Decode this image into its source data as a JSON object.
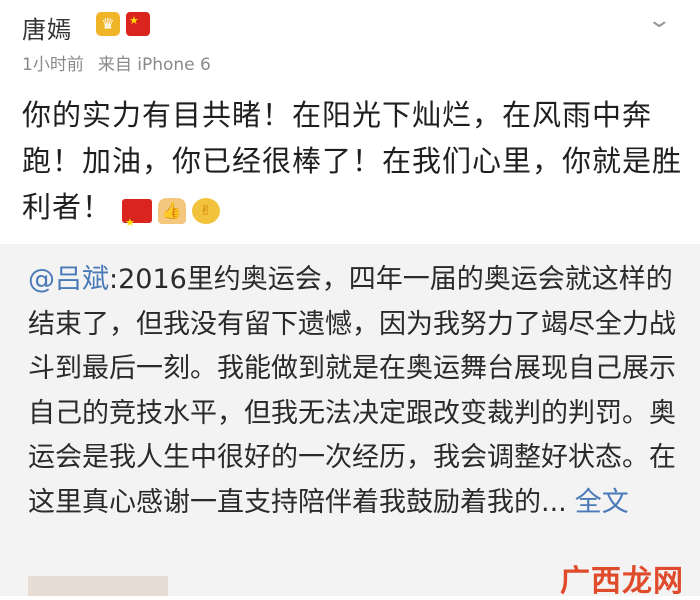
{
  "post": {
    "username": "唐嫣",
    "time": "1小时前",
    "source": "来自 iPhone 6",
    "text": "你的实力有目共睹！在阳光下灿烂，在风雨中奔跑！加油，你已经很棒了！在我们心里，你就是胜利者！",
    "badges": [
      "crown-badge-icon",
      "china-flag-badge-icon"
    ],
    "emojis": [
      "china-flag-emoji",
      "thumbs-up-emoji",
      "cheer-emoji"
    ]
  },
  "repost": {
    "mention": "@吕斌",
    "text": ":2016里约奥运会，四年一届的奥运会就这样的结束了，但我没有留下遗憾，因为我努力了竭尽全力战斗到最后一刻。我能做到就是在奥运舞台展现自己展示自己的竞技水平，但我无法决定跟改变裁判的判罚。奥运会是我人生中很好的一次经历，我会调整好状态。在这里真心感谢一直支持陪伴着我鼓励着我的...",
    "more_label": "全文"
  },
  "watermark": "广西龙网",
  "colors": {
    "link": "#4a7ab8",
    "repost_bg": "#f3f3f3",
    "watermark": "#e04b2c"
  }
}
